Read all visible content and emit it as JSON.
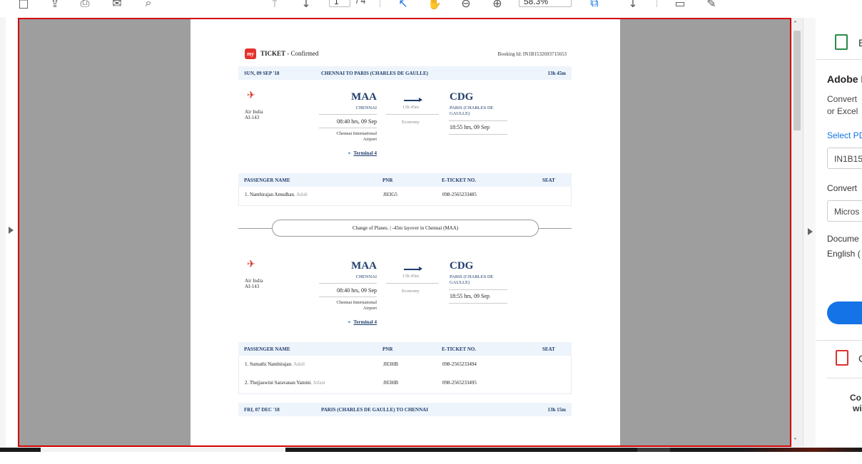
{
  "toolbar": {
    "page_current": "1",
    "page_total": "/ 4",
    "zoom": "58.3%"
  },
  "ticket": {
    "title_bold": "TICKET",
    "title_rest": " - Confirmed",
    "booking_id": "Booking Id: IN1B1532693715653",
    "leg1": {
      "date": "SUN, 09 SEP '18",
      "route": "CHENNAI TO PARIS (CHARLES DE GAULLE)",
      "duration": "13h 45m"
    },
    "segments": [
      {
        "airline": "Air India",
        "flight": "AI-143",
        "from_code": "MAA",
        "from_city": "CHENNAI",
        "dep_time": "08:40 hrs, 09 Sep",
        "from_airport_1": "Chennai International",
        "from_airport_2": "Airport",
        "terminal": "Terminal 4",
        "duration": "13h 45m",
        "cabin": "Economy",
        "to_code": "CDG",
        "to_city_1": "PARIS (CHARLES DE",
        "to_city_2": "GAULLE)",
        "arr_time": "18:55 hrs, 09 Sep"
      },
      {
        "airline": "Air India",
        "flight": "AI-143",
        "from_code": "MAA",
        "from_city": "CHENNAI",
        "dep_time": "08:40 hrs, 09 Sep",
        "from_airport_1": "Chennai International",
        "from_airport_2": "Airport",
        "terminal": "Terminal 4",
        "duration": "13h 45m",
        "cabin": "Economy",
        "to_code": "CDG",
        "to_city_1": "PARIS (CHARLES DE",
        "to_city_2": "GAULLE)",
        "arr_time": "18:55 hrs, 09 Sep"
      }
    ],
    "columns": {
      "name": "PASSENGER NAME",
      "pnr": "PNR",
      "eticket": "E-TICKET NO.",
      "seat": "SEAT"
    },
    "passengers_1": [
      {
        "num": "1.",
        "name": "Nambirajan Amudhan",
        "type": ", Adult",
        "pnr": "JH3G5",
        "eticket": "098-2565233485"
      }
    ],
    "passengers_2": [
      {
        "num": "1.",
        "name": "Sumathi Nambirajan",
        "type": ", Adult",
        "pnr": "JH3HB",
        "eticket": "098-2565233494"
      },
      {
        "num": "2.",
        "name": "Thejjaswini Saravanan Yamini",
        "type": ", Infant",
        "pnr": "JH3HB",
        "eticket": "098-2565233495"
      }
    ],
    "layover": "Change of Planes.  |  -45m layover in Chennai (MAA)",
    "leg2": {
      "date": "FRI, 07 DEC '18",
      "route": "PARIS (CHARLES DE GAULLE) TO CHENNAI",
      "duration": "13h 15m"
    }
  },
  "panel": {
    "export_label": "E",
    "title": "Adobe E",
    "desc_1": "Convert",
    "desc_2": "or Excel",
    "select_label": "Select PD",
    "file": "IN1B15",
    "convert_label": "Convert",
    "format": "Micros",
    "doc_1": "Docume",
    "doc_2": "English (",
    "create_label": "C",
    "promo_1": "Co",
    "promo_2": "wi"
  }
}
